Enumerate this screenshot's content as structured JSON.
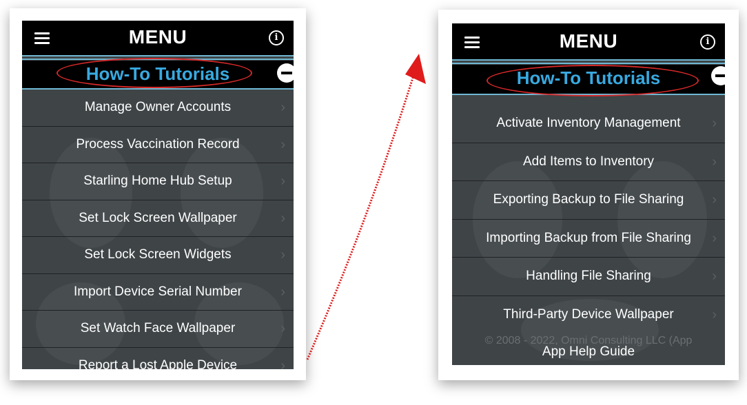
{
  "left": {
    "header": {
      "title": "MENU",
      "info_glyph": "i"
    },
    "section": {
      "title": "How-To Tutorials"
    },
    "items": [
      "Manage Owner Accounts",
      "Process Vaccination Record",
      "Starling Home Hub Setup",
      "Set Lock Screen Wallpaper",
      "Set Lock Screen Widgets",
      "Import Device Serial Number",
      "Set Watch Face Wallpaper",
      "Report a Lost Apple Device"
    ]
  },
  "right": {
    "header": {
      "title": "MENU",
      "info_glyph": "i"
    },
    "section": {
      "title": "How-To Tutorials"
    },
    "items": [
      "Activate Inventory Management",
      "Add Items to Inventory",
      "Exporting Backup to File Sharing",
      "Importing Backup from File Sharing",
      "Handling File Sharing",
      "Third-Party Device Wallpaper"
    ],
    "footer": {
      "copyright": "© 2008 - 2022, Omni Consulting LLC (App",
      "link": "App Help Guide"
    }
  },
  "colors": {
    "highlight_oval": "#d62828",
    "arrow": "#e01b1b",
    "section_text": "#39a9e0",
    "panel_bg": "#3f4447"
  },
  "icons": {
    "menu": "hamburger-icon",
    "info": "info-icon",
    "collapse": "minus-circle-icon",
    "row": "chevron-right-icon"
  }
}
